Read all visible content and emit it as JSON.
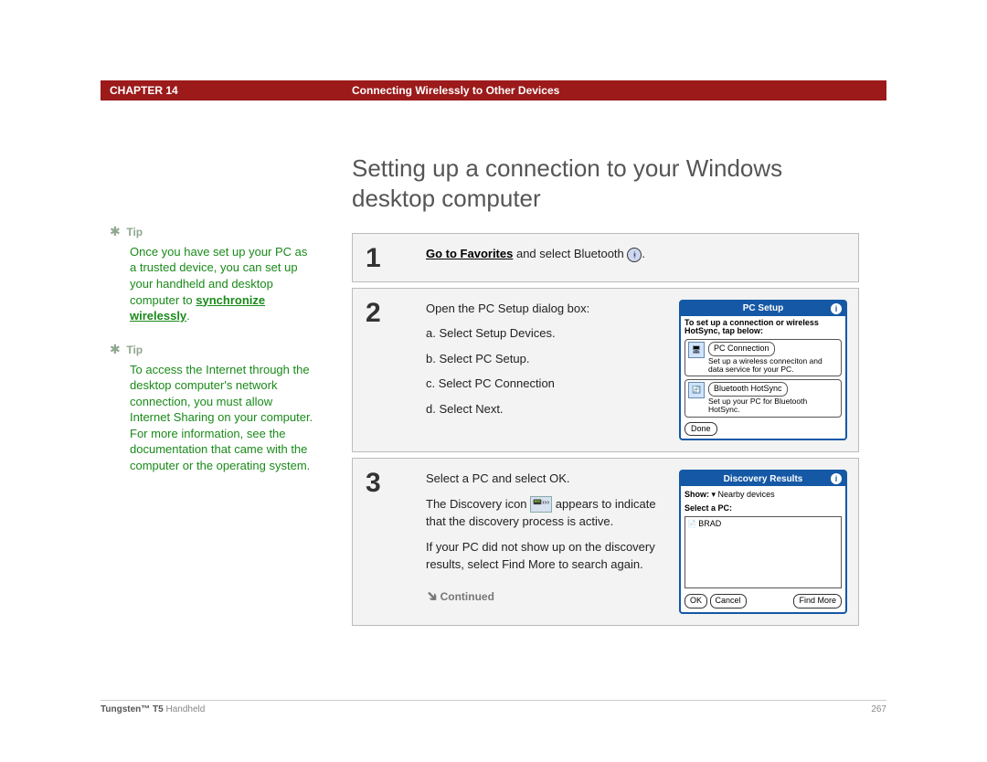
{
  "header": {
    "chapter": "CHAPTER 14",
    "title": "Connecting Wirelessly to Other Devices"
  },
  "page_title": "Setting up a connection to your Windows desktop computer",
  "sidebar": {
    "tips": [
      {
        "label": "Tip",
        "body_before": "Once you have set up your PC as a trusted device, you can set up your handheld and desktop computer to ",
        "link": "synchronize wirelessly",
        "body_after": "."
      },
      {
        "label": "Tip",
        "body_before": "To access the Internet through the desktop computer's network connection, you must allow Internet Sharing on your computer. For more information, see the documentation that came with the computer or the operating system.",
        "link": "",
        "body_after": ""
      }
    ]
  },
  "steps": [
    {
      "num": "1",
      "link_text": "Go to Favorites",
      "trailing": " and select Bluetooth ",
      "end_punct": "."
    },
    {
      "num": "2",
      "intro": "Open the PC Setup dialog box:",
      "lines": [
        "a.  Select Setup Devices.",
        "b.  Select PC Setup.",
        "c.  Select PC Connection",
        "d.  Select Next."
      ],
      "pda": {
        "title": "PC Setup",
        "instr": "To set up a connection or wireless HotSync, tap below:",
        "opt1_title": "PC Connection",
        "opt1_desc": "Set up a wireless conneciton and data service for your PC.",
        "opt2_title": "Bluetooth HotSync",
        "opt2_desc": "Set up your PC for Bluetooth HotSync.",
        "done": "Done"
      }
    },
    {
      "num": "3",
      "p1": "Select a PC and select OK.",
      "p2_before": "The Discovery icon ",
      "p2_after": " appears to indicate that the discovery process is active.",
      "p3": "If your PC did not show up on the discovery results, select Find More to search again.",
      "continued": "Continued",
      "disc": {
        "title": "Discovery Results",
        "show_label": "Show:",
        "show_value": "Nearby devices",
        "select_label": "Select a PC:",
        "item": "BRAD",
        "ok": "OK",
        "cancel": "Cancel",
        "find_more": "Find More"
      }
    }
  ],
  "footer": {
    "product_bold": "Tungsten™ T5",
    "product_rest": " Handheld",
    "page": "267"
  }
}
